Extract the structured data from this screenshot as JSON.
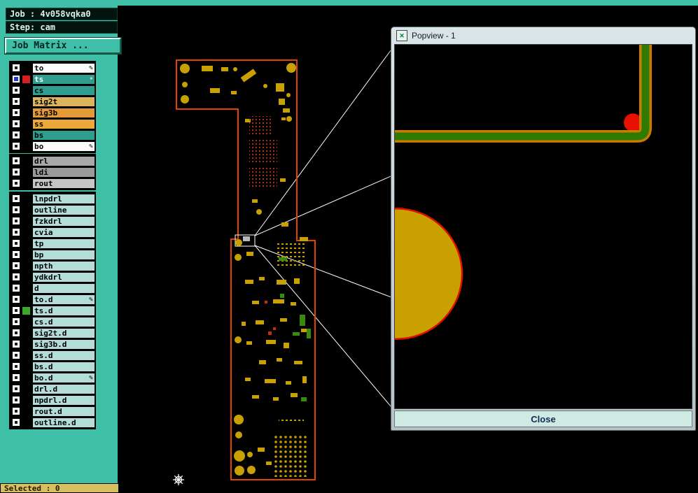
{
  "popup": {
    "title": "Popview - 1",
    "close_label": "Close"
  },
  "sidebar": {
    "job_label": "Job : 4v058vqka0",
    "step_label": "Step: cam",
    "job_matrix_label": "Job Matrix ...",
    "selected_label": "Selected : 0",
    "rows": [
      {
        "name": "to",
        "color": "#fafafa",
        "editable": true
      },
      {
        "name": "ts",
        "color": "#2f9e8e",
        "active": true
      },
      {
        "name": "cs",
        "color": "#2f9e8e"
      },
      {
        "name": "sig2t",
        "color": "#ddb45e"
      },
      {
        "name": "sig3b",
        "color": "#e49a39"
      },
      {
        "name": "ss",
        "color": "#eca839"
      },
      {
        "name": "bs",
        "color": "#2f9e8e"
      },
      {
        "name": "bo",
        "color": "#fafafa",
        "editable": true
      },
      {
        "name": "drl",
        "color": "#a8a8a8"
      },
      {
        "name": "ldi",
        "color": "#9a9a9a"
      },
      {
        "name": "rout",
        "color": "#c6c6c6"
      },
      {
        "name": "lnpdrl",
        "color": "#b4dcd8"
      },
      {
        "name": "outline",
        "color": "#b4dcd8"
      },
      {
        "name": "fzkdrl",
        "color": "#b4dcd8"
      },
      {
        "name": "cvia",
        "color": "#b4dcd8"
      },
      {
        "name": "tp",
        "color": "#b4dcd8"
      },
      {
        "name": "bp",
        "color": "#b4dcd8"
      },
      {
        "name": "npth",
        "color": "#b4dcd8"
      },
      {
        "name": "ydkdrl",
        "color": "#b4dcd8"
      },
      {
        "name": "d",
        "color": "#b4dcd8"
      },
      {
        "name": "to.d",
        "color": "#b4dcd8",
        "editable": true
      },
      {
        "name": "ts.d",
        "color": "#b4dcd8",
        "marked": true
      },
      {
        "name": "cs.d",
        "color": "#b4dcd8"
      },
      {
        "name": "sig2t.d",
        "color": "#b4dcd8"
      },
      {
        "name": "sig3b.d",
        "color": "#b4dcd8"
      },
      {
        "name": "ss.d",
        "color": "#b4dcd8"
      },
      {
        "name": "bs.d",
        "color": "#b4dcd8"
      },
      {
        "name": "bo.d",
        "color": "#b4dcd8",
        "editable": true
      },
      {
        "name": "drl.d",
        "color": "#b4dcd8"
      },
      {
        "name": "npdrl.d",
        "color": "#b4dcd8"
      },
      {
        "name": "rout.d",
        "color": "#b4dcd8"
      },
      {
        "name": "outline.d",
        "color": "#b4dcd8"
      }
    ]
  },
  "icons": {
    "pencil": "✎",
    "window_icon": "✕",
    "active_indicator": "∘"
  },
  "colors": {
    "sidebar_bg": "#3fbfa8",
    "canvas_bg": "#000000",
    "board_outline": "#e04400",
    "pad_yellow": "#c8a000",
    "trace_green": "#2f7a00",
    "trace_edge_orange": "#cc7a00",
    "pad_red": "#e81000",
    "active_checkbox_blue": "#2238c8",
    "active_mark_red": "#d42020",
    "ts_d_mark_green": "#3aa828",
    "selected_bar_bg": "#d9c05e"
  }
}
